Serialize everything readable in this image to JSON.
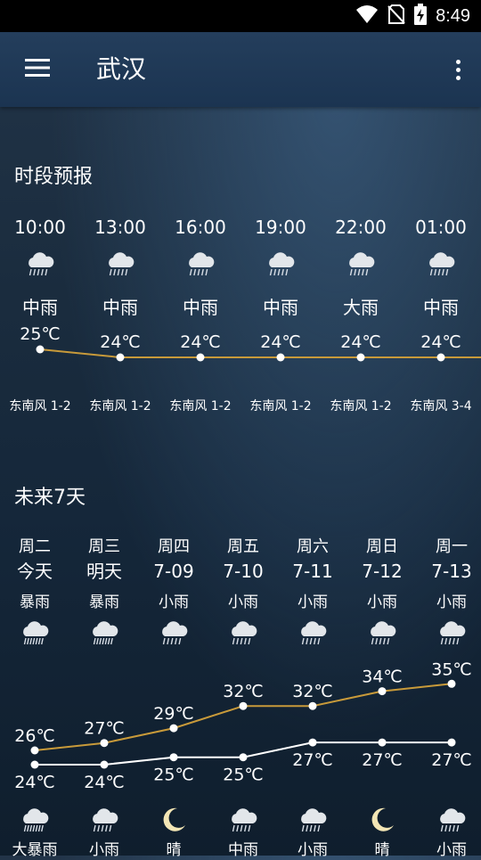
{
  "status_bar": {
    "time": "8:49"
  },
  "app_bar": {
    "title": "武汉"
  },
  "hourly": {
    "title": "时段预报",
    "items": [
      {
        "time": "10:00",
        "icon": "rain-cloud-icon",
        "condition": "中雨",
        "temp": "25℃",
        "temp_value": 25,
        "wind": "东南风 1-2"
      },
      {
        "time": "13:00",
        "icon": "rain-cloud-icon",
        "condition": "中雨",
        "temp": "24℃",
        "temp_value": 24,
        "wind": "东南风 1-2"
      },
      {
        "time": "16:00",
        "icon": "rain-cloud-icon",
        "condition": "中雨",
        "temp": "24℃",
        "temp_value": 24,
        "wind": "东南风 1-2"
      },
      {
        "time": "19:00",
        "icon": "rain-cloud-icon",
        "condition": "中雨",
        "temp": "24℃",
        "temp_value": 24,
        "wind": "东南风 1-2"
      },
      {
        "time": "22:00",
        "icon": "rain-cloud-icon",
        "condition": "大雨",
        "temp": "24℃",
        "temp_value": 24,
        "wind": "东南风 1-2"
      },
      {
        "time": "01:00",
        "icon": "rain-cloud-icon",
        "condition": "中雨",
        "temp": "24℃",
        "temp_value": 24,
        "wind": "东南风 3-4"
      }
    ]
  },
  "daily": {
    "title": "未来7天",
    "items": [
      {
        "weekday": "周二",
        "date": "今天",
        "day_condition": "暴雨",
        "day_icon": "heavy-rain-icon",
        "high": "26℃",
        "high_value": 26,
        "low": "24℃",
        "low_value": 24,
        "night_icon": "heavy-rain-icon",
        "night_condition": "大暴雨"
      },
      {
        "weekday": "周三",
        "date": "明天",
        "day_condition": "暴雨",
        "day_icon": "heavy-rain-icon",
        "high": "27℃",
        "high_value": 27,
        "low": "24℃",
        "low_value": 24,
        "night_icon": "rain-cloud-icon",
        "night_condition": "小雨"
      },
      {
        "weekday": "周四",
        "date": "7-09",
        "day_condition": "小雨",
        "day_icon": "rain-cloud-icon",
        "high": "29℃",
        "high_value": 29,
        "low": "25℃",
        "low_value": 25,
        "night_icon": "moon-icon",
        "night_condition": "晴"
      },
      {
        "weekday": "周五",
        "date": "7-10",
        "day_condition": "小雨",
        "day_icon": "rain-cloud-icon",
        "high": "32℃",
        "high_value": 32,
        "low": "25℃",
        "low_value": 25,
        "night_icon": "rain-cloud-icon",
        "night_condition": "中雨"
      },
      {
        "weekday": "周六",
        "date": "7-11",
        "day_condition": "小雨",
        "day_icon": "rain-cloud-icon",
        "high": "32℃",
        "high_value": 32,
        "low": "27℃",
        "low_value": 27,
        "night_icon": "rain-cloud-icon",
        "night_condition": "小雨"
      },
      {
        "weekday": "周日",
        "date": "7-12",
        "day_condition": "小雨",
        "day_icon": "rain-cloud-icon",
        "high": "34℃",
        "high_value": 34,
        "low": "27℃",
        "low_value": 27,
        "night_icon": "moon-icon",
        "night_condition": "晴"
      },
      {
        "weekday": "周一",
        "date": "7-13",
        "day_condition": "小雨",
        "day_icon": "rain-cloud-icon",
        "high": "35℃",
        "high_value": 35,
        "low": "27℃",
        "low_value": 27,
        "night_icon": "rain-cloud-icon",
        "night_condition": "小雨"
      }
    ]
  },
  "colors": {
    "high_line": "#c89a3a",
    "hourly_line": "#c89a3a",
    "low_line": "#ffffff"
  }
}
